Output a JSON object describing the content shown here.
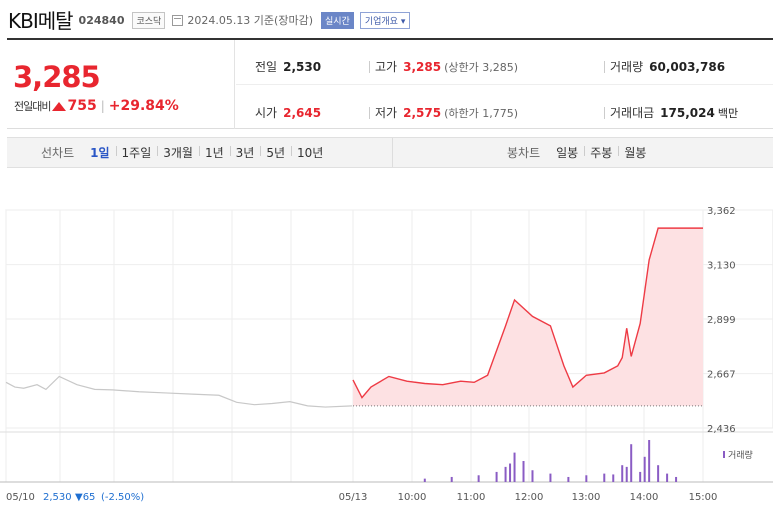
{
  "header": {
    "stock_name": "KBI메탈",
    "stock_code": "024840",
    "market": "코스닥",
    "date_text": "2024.05.13 기준(장마감)",
    "live_label": "실시간",
    "company_button": "기업개요 ▾"
  },
  "summary": {
    "price": "3,285",
    "change_label": "전일대비",
    "change_value": "755",
    "change_percent": "+29.84%",
    "prev_close": {
      "label": "전일",
      "value": "2,530"
    },
    "open": {
      "label": "시가",
      "value": "2,645"
    },
    "high": {
      "label": "고가",
      "value": "3,285",
      "sub": "(상한가 3,285)"
    },
    "low": {
      "label": "저가",
      "value": "2,575",
      "sub": "(하한가 1,775)"
    },
    "volume": {
      "label": "거래량",
      "value": "60,003,786"
    },
    "amount": {
      "label": "거래대금",
      "value": "175,024",
      "unit": "백만"
    }
  },
  "tabs": {
    "line_title": "선차트",
    "line_periods": [
      "1일",
      "1주일",
      "3개월",
      "1년",
      "3년",
      "5년",
      "10년"
    ],
    "active_line": "1일",
    "candle_title": "봉차트",
    "candle_periods": [
      "일봉",
      "주봉",
      "월봉"
    ]
  },
  "chart_data": {
    "type": "line",
    "y_ticks": [
      "3,362",
      "3,130",
      "2,899",
      "2,667",
      "2,436"
    ],
    "ylim": [
      2436,
      3362
    ],
    "x_labels": [
      "05/10",
      "05/13",
      "10:00",
      "11:00",
      "12:00",
      "13:00",
      "14:00",
      "15:00"
    ],
    "reference_price": 2530,
    "volume_legend": "거래량",
    "prev_day_summary": {
      "close": "2,530",
      "change": "▼65",
      "pct": "(-2.50%)"
    },
    "prev_day_series": {
      "x": [
        "05/10 09:00",
        "09:10",
        "09:20",
        "09:35",
        "09:45",
        "10:00",
        "10:20",
        "10:40",
        "11:00",
        "11:30",
        "12:00",
        "12:30",
        "13:00",
        "13:20",
        "13:40",
        "14:00",
        "14:20",
        "14:40",
        "15:00",
        "15:30"
      ],
      "values": [
        2630,
        2610,
        2605,
        2620,
        2600,
        2655,
        2620,
        2600,
        2598,
        2590,
        2585,
        2580,
        2575,
        2545,
        2535,
        2540,
        2548,
        2530,
        2525,
        2530
      ]
    },
    "today_series": {
      "x": [
        "05/13 09:00",
        "09:10",
        "09:20",
        "09:40",
        "10:00",
        "10:20",
        "10:40",
        "11:00",
        "11:15",
        "11:30",
        "11:50",
        "12:00",
        "12:20",
        "12:40",
        "12:55",
        "13:05",
        "13:20",
        "13:40",
        "13:55",
        "14:00",
        "14:05",
        "14:10",
        "14:20",
        "14:30",
        "14:40",
        "14:50",
        "15:00",
        "15:30"
      ],
      "values": [
        2640,
        2565,
        2610,
        2655,
        2635,
        2625,
        2620,
        2635,
        2630,
        2660,
        2870,
        2980,
        2910,
        2870,
        2700,
        2610,
        2660,
        2670,
        2700,
        2735,
        2860,
        2740,
        2880,
        3150,
        3285,
        3285,
        3285,
        3285
      ]
    },
    "today_volume": {
      "x": [
        "10:20",
        "10:50",
        "11:20",
        "11:40",
        "11:50",
        "11:55",
        "12:00",
        "12:10",
        "12:20",
        "12:40",
        "13:00",
        "13:20",
        "13:40",
        "13:50",
        "14:00",
        "14:05",
        "14:10",
        "14:20",
        "14:25",
        "14:30",
        "14:40",
        "14:50",
        "15:00"
      ],
      "values": [
        4,
        6,
        8,
        12,
        18,
        22,
        35,
        25,
        14,
        10,
        6,
        8,
        10,
        9,
        20,
        18,
        45,
        12,
        30,
        50,
        20,
        10,
        6
      ]
    }
  }
}
